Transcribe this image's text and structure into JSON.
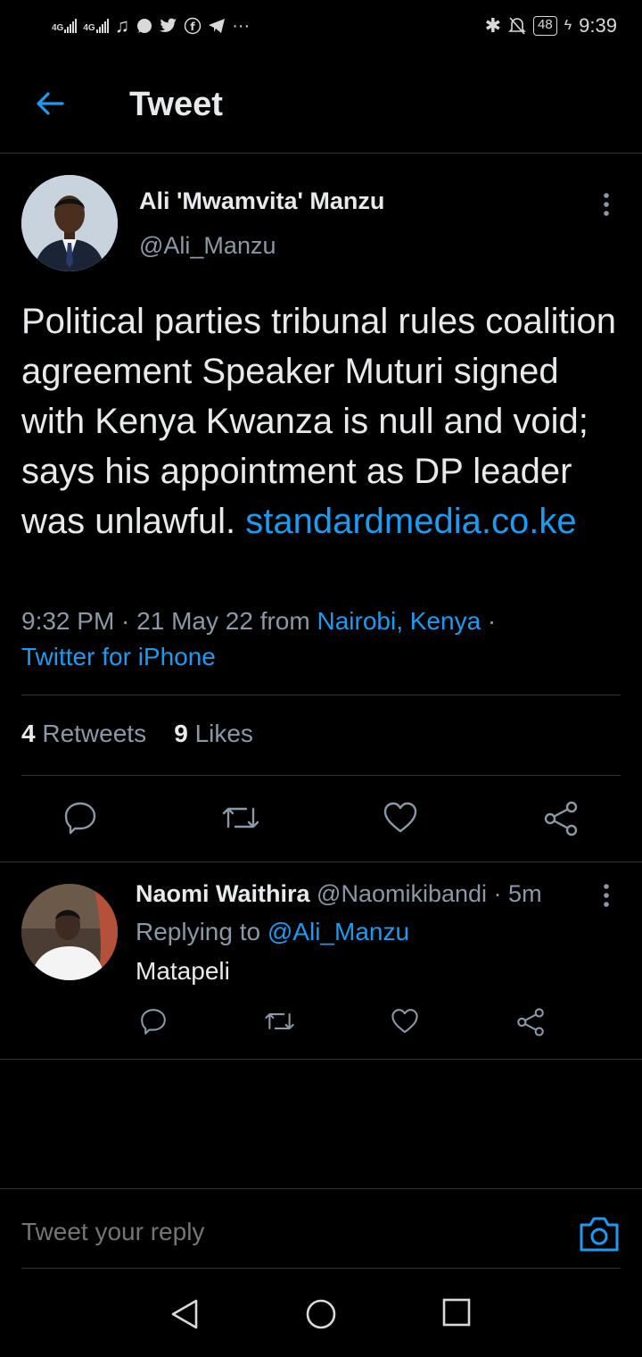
{
  "status_bar": {
    "net1": "4G",
    "net2": "4G",
    "battery": "48",
    "time": "9:39"
  },
  "header": {
    "title": "Tweet"
  },
  "tweet": {
    "author_name": "Ali 'Mwamvita' Manzu",
    "author_handle": "@Ali_Manzu",
    "text": "Political parties tribunal rules coalition agreement Speaker Muturi signed with Kenya Kwanza is null and void; says his appointment as DP leader was unlawful. ",
    "link": "standardmedia.co.ke",
    "time": "9:32 PM",
    "date": "21 May 22",
    "from_label": "from",
    "location": "Nairobi, Kenya",
    "sep": " · ",
    "source": "Twitter for iPhone",
    "retweets_count": "4",
    "retweets_label": "Retweets",
    "likes_count": "9",
    "likes_label": "Likes"
  },
  "reply": {
    "author_name": "Naomi Waithira",
    "author_handle": "@Naomikibandi",
    "age": "5m",
    "replying_label": "Replying to",
    "replying_to": "@Ali_Manzu",
    "text": "Matapeli"
  },
  "compose": {
    "placeholder": "Tweet your reply"
  },
  "colors": {
    "background": "#000000",
    "accent": "#1d9bf0",
    "text": "#e7e9ea",
    "muted": "#8b98a5",
    "divider": "#2f3336"
  }
}
